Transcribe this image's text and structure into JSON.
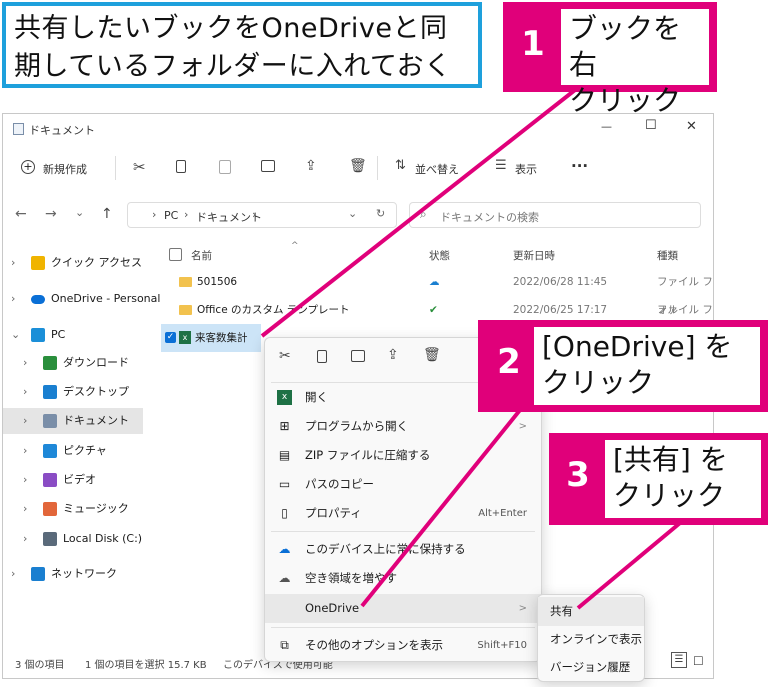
{
  "callouts": {
    "intro": {
      "line1": "共有したいブックをOneDriveと同",
      "line2": "期しているフォルダーに入れておく"
    },
    "step1": {
      "num": "1",
      "line1": "ブックを右",
      "line2": "クリック"
    },
    "step2": {
      "num": "2",
      "line1": "[OneDrive] を",
      "line2": "クリック"
    },
    "step3": {
      "num": "3",
      "line1": "[共有] を",
      "line2": "クリック"
    }
  },
  "window": {
    "title": "ドキュメント",
    "controls": {
      "minimize": "—",
      "maximize": "☐",
      "close": "✕"
    },
    "toolbar": {
      "new": "新規作成",
      "sort": "並べ替え",
      "view": "表示",
      "more": "···"
    },
    "address": {
      "path": [
        "PC",
        "ドキュメント"
      ],
      "search_placeholder": "ドキュメントの検索"
    },
    "nav": [
      {
        "label": "クイック アクセス",
        "icon": "star-icon",
        "color": "#f0b400",
        "chev": "›"
      },
      {
        "label": "OneDrive - Personal",
        "icon": "cloud-icon",
        "color": "#0a6fd6",
        "chev": "›"
      },
      {
        "label": "PC",
        "icon": "monitor-icon",
        "color": "#1b8fd8",
        "chev": "⌄"
      },
      {
        "label": "ダウンロード",
        "icon": "download-icon",
        "color": "#2a8f3c",
        "chev": "›"
      },
      {
        "label": "デスクトップ",
        "icon": "desktop-icon",
        "color": "#1a7fd0",
        "chev": "›"
      },
      {
        "label": "ドキュメント",
        "icon": "document-icon",
        "color": "#7a8ea8",
        "chev": "›"
      },
      {
        "label": "ピクチャ",
        "icon": "picture-icon",
        "color": "#1e88d8",
        "chev": "›"
      },
      {
        "label": "ビデオ",
        "icon": "video-icon",
        "color": "#8a4cc4",
        "chev": "›"
      },
      {
        "label": "ミュージック",
        "icon": "music-icon",
        "color": "#e2663a",
        "chev": "›"
      },
      {
        "label": "Local Disk (C:)",
        "icon": "disk-icon",
        "color": "#5a6a7a",
        "chev": "›"
      },
      {
        "label": "ネットワーク",
        "icon": "network-icon",
        "color": "#1a7fd0",
        "chev": "›"
      }
    ],
    "columns": {
      "name": "名前",
      "status": "状態",
      "date": "更新日時",
      "type": "種類"
    },
    "files": [
      {
        "name": "501506",
        "date": "2022/06/28 11:45",
        "type": "ファイル フォル"
      },
      {
        "name": "Office のカスタム テンプレート",
        "date": "2022/06/25 17:17",
        "type": "ファイル フォル"
      },
      {
        "name": "来客数集計",
        "date": "",
        "type": ""
      }
    ],
    "statusbar": {
      "count": "3 個の項目",
      "selected": "1 個の項目を選択  15.7 KB",
      "extra": "このデバイスで使用可能"
    }
  },
  "context_menu": {
    "items": [
      {
        "label": "開く",
        "icon": "excel-icon",
        "shortcut": ""
      },
      {
        "label": "プログラムから開く",
        "icon": "open-with-icon",
        "shortcut": ">"
      },
      {
        "label": "ZIP ファイルに圧縮する",
        "icon": "zip-icon",
        "shortcut": ""
      },
      {
        "label": "パスのコピー",
        "icon": "copy-path-icon",
        "shortcut": ""
      },
      {
        "label": "プロパティ",
        "icon": "properties-icon",
        "shortcut": "Alt+Enter"
      },
      {
        "label": "このデバイス上に常に保持する",
        "icon": "keep-device-icon",
        "shortcut": ""
      },
      {
        "label": "空き領域を増やす",
        "icon": "cloud-outline-icon",
        "shortcut": ""
      },
      {
        "label": "OneDrive",
        "icon": "",
        "shortcut": ">"
      },
      {
        "label": "その他のオプションを表示",
        "icon": "more-options-icon",
        "shortcut": "Shift+F10"
      }
    ]
  },
  "submenu": {
    "items": [
      "共有",
      "オンラインで表示",
      "バージョン履歴"
    ]
  },
  "colors": {
    "accent_pink": "#e0007a",
    "accent_blue": "#1ea0dc",
    "selection": "#cce4f7"
  }
}
